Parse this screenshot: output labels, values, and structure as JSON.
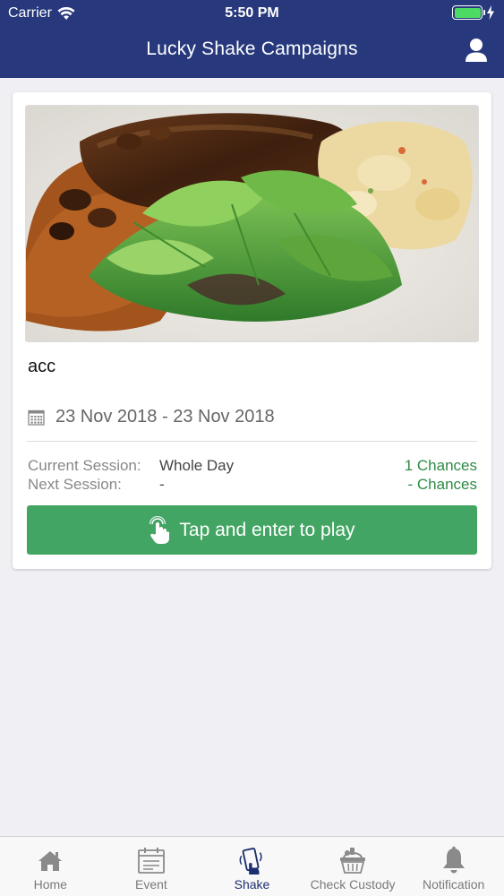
{
  "status_bar": {
    "carrier": "Carrier",
    "time": "5:50 PM"
  },
  "nav": {
    "title": "Lucky Shake Campaigns"
  },
  "campaign": {
    "title": "acc",
    "date_range": "23 Nov 2018 - 23 Nov 2018",
    "current_session_label": "Current Session:",
    "current_session_value": "Whole Day",
    "current_chances": "1 Chances",
    "next_session_label": "Next Session:",
    "next_session_value": "-",
    "next_chances": "- Chances",
    "play_button": "Tap and enter to play"
  },
  "tabs": [
    {
      "label": "Home",
      "icon": "home-icon"
    },
    {
      "label": "Event",
      "icon": "calendar-icon"
    },
    {
      "label": "Shake",
      "icon": "shake-phone-icon"
    },
    {
      "label": "Check Custody",
      "icon": "basket-icon"
    },
    {
      "label": "Notification",
      "icon": "bell-icon"
    }
  ],
  "colors": {
    "header": "#27397c",
    "play_button": "#43a563",
    "chances": "#2e8b45",
    "active_tab": "#1c2e6e"
  }
}
